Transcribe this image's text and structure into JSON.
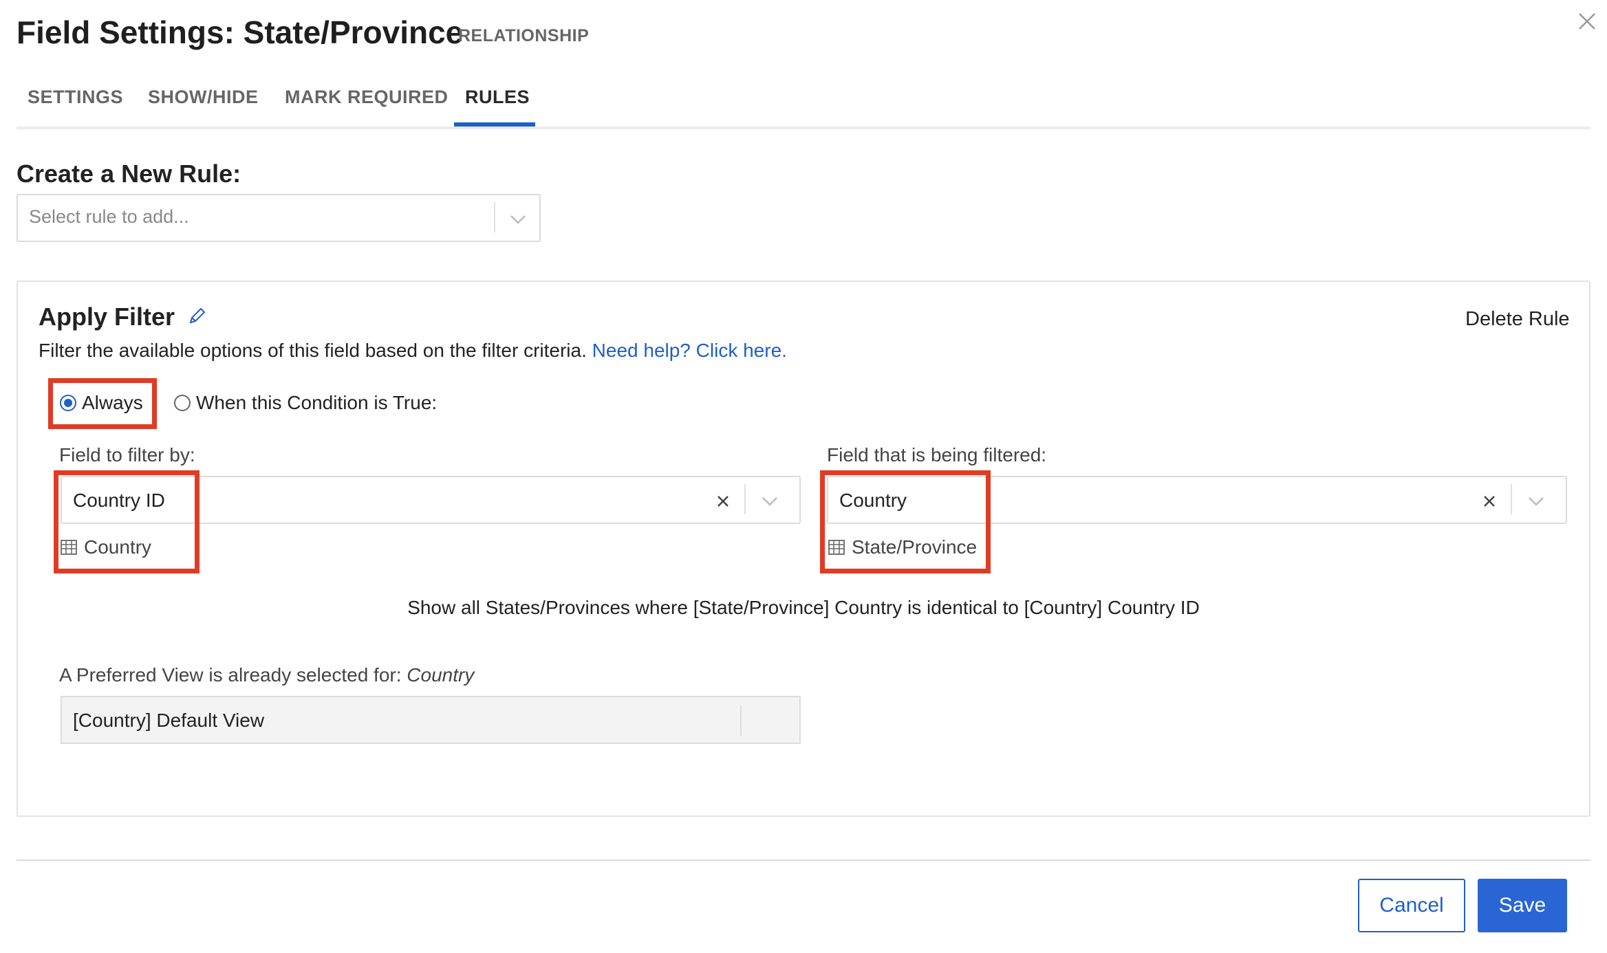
{
  "dialog": {
    "title": "Field Settings: State/Province",
    "field_type": "RELATIONSHIP",
    "close_icon": "close-icon"
  },
  "tabs": [
    {
      "label": "SETTINGS",
      "active": false
    },
    {
      "label": "SHOW/HIDE",
      "active": false
    },
    {
      "label": "MARK REQUIRED",
      "active": false
    },
    {
      "label": "RULES",
      "active": true
    }
  ],
  "create_rule": {
    "heading": "Create a New Rule:",
    "placeholder": "Select rule to add..."
  },
  "rule": {
    "title": "Apply Filter",
    "edit_icon": "pencil-icon",
    "delete_label": "Delete Rule",
    "description": "Filter the available options of this field based on the filter criteria.",
    "help_link": "Need help? Click here.",
    "condition": {
      "options": [
        {
          "label": "Always",
          "selected": true
        },
        {
          "label": "When this Condition is True:",
          "selected": false
        }
      ]
    },
    "filter_by": {
      "label": "Field to filter by:",
      "value": "Country ID",
      "source_table": "Country"
    },
    "being_filtered": {
      "label": "Field that is being filtered:",
      "value": "Country",
      "source_table": "State/Province"
    },
    "summary": "Show all States/Provinces where [State/Province] Country is identical to [Country] Country ID",
    "preferred_view": {
      "label_prefix": "A Preferred View is already selected for:",
      "label_table": "Country",
      "value": "[Country] Default View"
    }
  },
  "footer": {
    "cancel_label": "Cancel",
    "save_label": "Save"
  },
  "colors": {
    "accent": "#1f5fc8",
    "highlight": "#e03b24"
  }
}
